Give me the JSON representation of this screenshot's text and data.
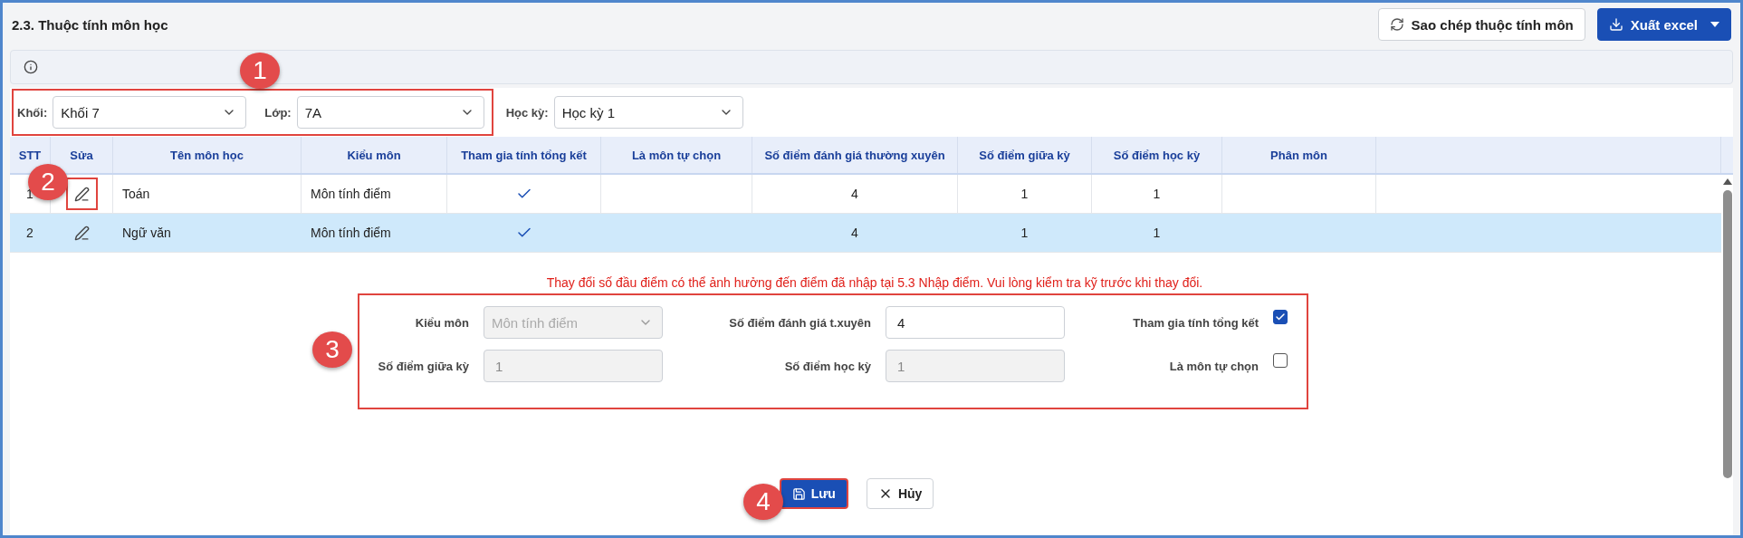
{
  "page_title": "2.3. Thuộc tính môn học",
  "toolbar_buttons": [
    {
      "kind": "copy",
      "label": "Sao chép thuộc tính môn"
    },
    {
      "kind": "export",
      "label": "Xuất excel"
    }
  ],
  "filters": [
    {
      "label": "Khối:",
      "value": "Khối 7"
    },
    {
      "label": "Lớp:",
      "value": "7A"
    },
    {
      "label": "Học kỳ:",
      "value": "Học kỳ 1"
    }
  ],
  "table": {
    "columns": [
      "STT",
      "Sửa",
      "Tên môn học",
      "Kiểu môn",
      "Tham gia tính tổng kết",
      "Là môn tự chọn",
      "Số điểm đánh giá thường xuyên",
      "Số điểm giữa kỳ",
      "Số điểm học kỳ",
      "Phân môn"
    ],
    "rows": [
      {
        "stt": "1",
        "name": "Toán",
        "type": "Môn tính điểm",
        "counted": true,
        "optional": false,
        "regular": "4",
        "midterm": "1",
        "final": "1",
        "selected": false
      },
      {
        "stt": "2",
        "name": "Ngữ văn",
        "type": "Môn tính điểm",
        "counted": true,
        "optional": false,
        "regular": "4",
        "midterm": "1",
        "final": "1",
        "selected": true
      }
    ]
  },
  "warning": "Thay đổi số đầu điểm có thể ảnh hưởng đến điểm đã nhập tại 5.3 Nhập điểm. Vui lòng kiểm tra kỹ trước khi thay đổi.",
  "form": {
    "fields": [
      {
        "kind": "select",
        "label": "Kiểu môn",
        "value": "Môn tính điểm",
        "disabled": true
      },
      {
        "kind": "input",
        "label": "Số điểm đánh giá t.xuyên",
        "value": "4",
        "disabled": false
      },
      {
        "kind": "checkbox",
        "label": "Tham gia tính tổng kết",
        "checked": true
      },
      {
        "kind": "input",
        "label": "Số điểm giữa kỳ",
        "value": "1",
        "disabled": true
      },
      {
        "kind": "input",
        "label": "Số điểm học kỳ",
        "value": "1",
        "disabled": true
      },
      {
        "kind": "checkbox",
        "label": "Là môn tự chọn",
        "checked": false
      }
    ]
  },
  "actions": [
    {
      "kind": "save",
      "label": "Lưu"
    },
    {
      "kind": "cancel",
      "label": "Hủy"
    }
  ],
  "callouts": [
    "1",
    "2",
    "3",
    "4"
  ]
}
